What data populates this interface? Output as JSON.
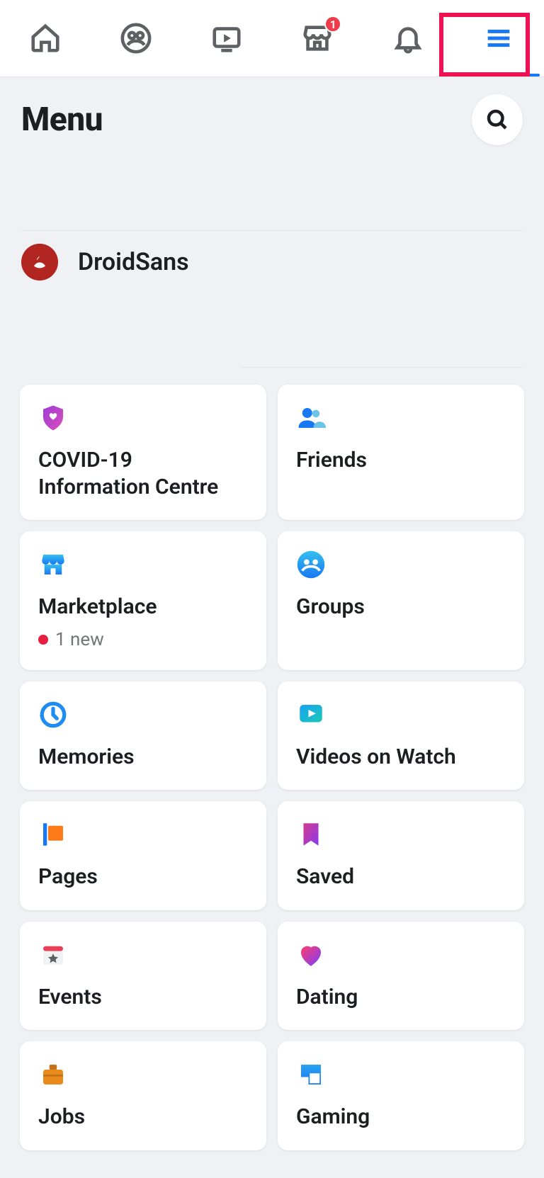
{
  "nav": {
    "active_tab": "menu",
    "marketplace_badge": "1"
  },
  "header": {
    "title": "Menu"
  },
  "profile": {
    "name": "DroidSans"
  },
  "grid": {
    "covid": "COVID-19 Information Centre",
    "friends": "Friends",
    "marketplace": "Marketplace",
    "marketplace_sub": "1 new",
    "groups": "Groups",
    "memories": "Memories",
    "videos": "Videos on Watch",
    "pages": "Pages",
    "saved": "Saved",
    "events": "Events",
    "dating": "Dating",
    "jobs": "Jobs",
    "gaming": "Gaming"
  }
}
